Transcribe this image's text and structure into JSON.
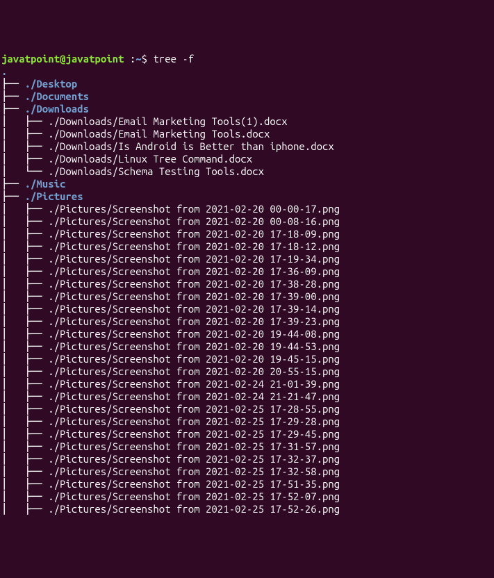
{
  "prompt": {
    "user": "javatpoint",
    "at": "@",
    "host": "javatpoint",
    "sep": " :",
    "path": "~",
    "symbol": "$ "
  },
  "command": "tree -f",
  "root": ".",
  "entries": [
    {
      "prefix": "├── ",
      "name": "./Desktop",
      "type": "dir"
    },
    {
      "prefix": "├── ",
      "name": "./Documents",
      "type": "dir"
    },
    {
      "prefix": "├── ",
      "name": "./Downloads",
      "type": "dir"
    },
    {
      "prefix": "│   ├── ",
      "name": "./Downloads/Email Marketing Tools(1).docx",
      "type": "file"
    },
    {
      "prefix": "│   ├── ",
      "name": "./Downloads/Email Marketing Tools.docx",
      "type": "file"
    },
    {
      "prefix": "│   ├── ",
      "name": "./Downloads/Is Android is Better than iphone.docx",
      "type": "file"
    },
    {
      "prefix": "│   ├── ",
      "name": "./Downloads/Linux Tree Command.docx",
      "type": "file"
    },
    {
      "prefix": "│   └── ",
      "name": "./Downloads/Schema Testing Tools.docx",
      "type": "file"
    },
    {
      "prefix": "├── ",
      "name": "./Music",
      "type": "dir"
    },
    {
      "prefix": "├── ",
      "name": "./Pictures",
      "type": "dir"
    },
    {
      "prefix": "│   ├── ",
      "name": "./Pictures/Screenshot from 2021-02-20 00-00-17.png",
      "type": "file"
    },
    {
      "prefix": "│   ├── ",
      "name": "./Pictures/Screenshot from 2021-02-20 00-08-16.png",
      "type": "file"
    },
    {
      "prefix": "│   ├── ",
      "name": "./Pictures/Screenshot from 2021-02-20 17-18-09.png",
      "type": "file"
    },
    {
      "prefix": "│   ├── ",
      "name": "./Pictures/Screenshot from 2021-02-20 17-18-12.png",
      "type": "file"
    },
    {
      "prefix": "│   ├── ",
      "name": "./Pictures/Screenshot from 2021-02-20 17-19-34.png",
      "type": "file"
    },
    {
      "prefix": "│   ├── ",
      "name": "./Pictures/Screenshot from 2021-02-20 17-36-09.png",
      "type": "file"
    },
    {
      "prefix": "│   ├── ",
      "name": "./Pictures/Screenshot from 2021-02-20 17-38-28.png",
      "type": "file"
    },
    {
      "prefix": "│   ├── ",
      "name": "./Pictures/Screenshot from 2021-02-20 17-39-00.png",
      "type": "file"
    },
    {
      "prefix": "│   ├── ",
      "name": "./Pictures/Screenshot from 2021-02-20 17-39-14.png",
      "type": "file"
    },
    {
      "prefix": "│   ├── ",
      "name": "./Pictures/Screenshot from 2021-02-20 17-39-23.png",
      "type": "file"
    },
    {
      "prefix": "│   ├── ",
      "name": "./Pictures/Screenshot from 2021-02-20 19-44-08.png",
      "type": "file"
    },
    {
      "prefix": "│   ├── ",
      "name": "./Pictures/Screenshot from 2021-02-20 19-44-53.png",
      "type": "file"
    },
    {
      "prefix": "│   ├── ",
      "name": "./Pictures/Screenshot from 2021-02-20 19-45-15.png",
      "type": "file"
    },
    {
      "prefix": "│   ├── ",
      "name": "./Pictures/Screenshot from 2021-02-20 20-55-15.png",
      "type": "file"
    },
    {
      "prefix": "│   ├── ",
      "name": "./Pictures/Screenshot from 2021-02-24 21-01-39.png",
      "type": "file"
    },
    {
      "prefix": "│   ├── ",
      "name": "./Pictures/Screenshot from 2021-02-24 21-21-47.png",
      "type": "file"
    },
    {
      "prefix": "│   ├── ",
      "name": "./Pictures/Screenshot from 2021-02-25 17-28-55.png",
      "type": "file"
    },
    {
      "prefix": "│   ├── ",
      "name": "./Pictures/Screenshot from 2021-02-25 17-29-28.png",
      "type": "file"
    },
    {
      "prefix": "│   ├── ",
      "name": "./Pictures/Screenshot from 2021-02-25 17-29-45.png",
      "type": "file"
    },
    {
      "prefix": "│   ├── ",
      "name": "./Pictures/Screenshot from 2021-02-25 17-31-57.png",
      "type": "file"
    },
    {
      "prefix": "│   ├── ",
      "name": "./Pictures/Screenshot from 2021-02-25 17-32-37.png",
      "type": "file"
    },
    {
      "prefix": "│   ├── ",
      "name": "./Pictures/Screenshot from 2021-02-25 17-32-58.png",
      "type": "file"
    },
    {
      "prefix": "│   ├── ",
      "name": "./Pictures/Screenshot from 2021-02-25 17-51-35.png",
      "type": "file"
    },
    {
      "prefix": "│   ├── ",
      "name": "./Pictures/Screenshot from 2021-02-25 17-52-07.png",
      "type": "file"
    },
    {
      "prefix": "│   ├── ",
      "name": "./Pictures/Screenshot from 2021-02-25 17-52-26.png",
      "type": "file"
    }
  ]
}
